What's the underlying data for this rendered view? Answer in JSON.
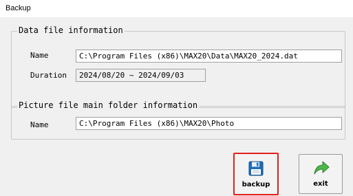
{
  "window": {
    "title": "Backup"
  },
  "data_file_group": {
    "legend": "Data file information",
    "name_label": "Name",
    "name_value": "C:\\Program Files (x86)\\MAX20\\Data\\MAX20_2024.dat",
    "duration_label": "Duration",
    "duration_value": "2024/08/20 ~ 2024/09/03"
  },
  "picture_group": {
    "legend": "Picture file main folder information",
    "name_label": "Name",
    "name_value": "C:\\Program Files (x86)\\MAX20\\Photo"
  },
  "buttons": {
    "backup_label": "backup",
    "backup_icon": "floppy-disk-icon",
    "exit_label": "exit",
    "exit_icon": "green-arrow-exit-icon",
    "highlight_color": "#e0201b"
  }
}
